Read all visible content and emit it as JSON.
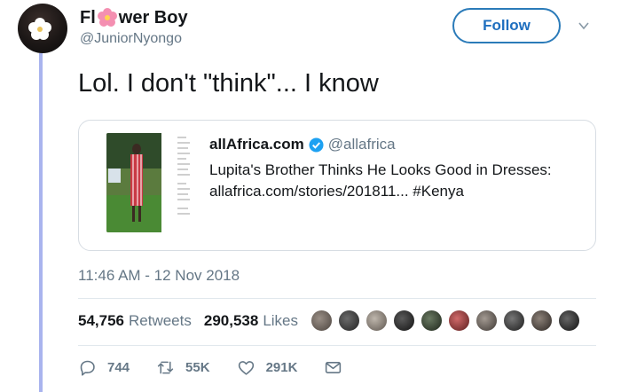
{
  "user": {
    "name_prefix": "Fl",
    "name_suffix": "wer Boy",
    "handle": "@JuniorNyongo",
    "follow_label": "Follow"
  },
  "tweet": {
    "text": "Lol. I don't \"think\"... I know",
    "timestamp": "11:46 AM - 12 Nov 2018"
  },
  "quote": {
    "name": "allAfrica.com",
    "handle": "@allafrica",
    "line1": "Lupita's Brother Thinks He Looks Good in Dresses:",
    "line2": "allafrica.com/stories/201811... #Kenya"
  },
  "stats": {
    "retweets_count": "54,756",
    "retweets_label": "Retweets",
    "likes_count": "290,538",
    "likes_label": "Likes"
  },
  "actions": {
    "replies": "744",
    "retweets": "55K",
    "likes": "291K"
  },
  "colors": {
    "accent": "#1da1f2",
    "follow_text": "#1f6fbf",
    "muted": "#657786",
    "thread_line": "#a9b4ee"
  },
  "icons": [
    "flower-icon",
    "verified-badge-icon",
    "chevron-down-icon",
    "reply-icon",
    "retweet-icon",
    "like-icon",
    "share-mail-icon"
  ]
}
